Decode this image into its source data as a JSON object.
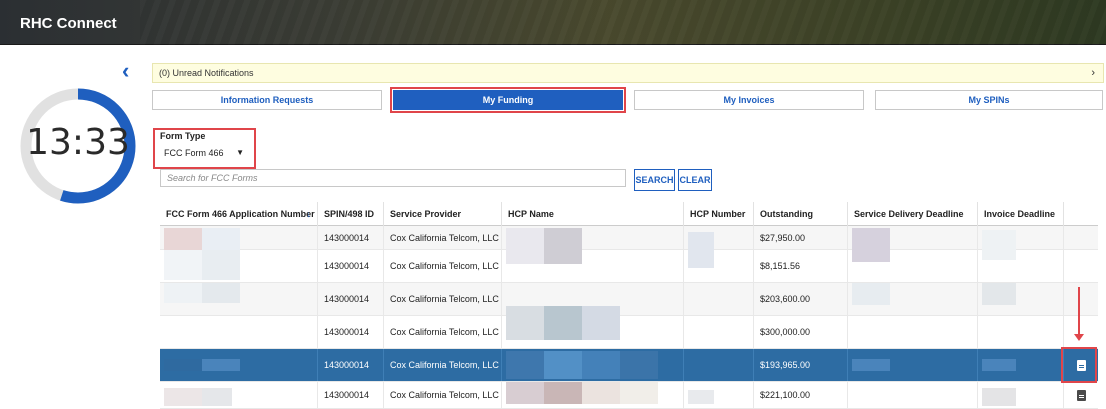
{
  "app": {
    "title": "RHC Connect"
  },
  "timer": {
    "time": "13:33",
    "remaining_fraction": 0.55
  },
  "notifications": {
    "label": "(0) Unread Notifications"
  },
  "tabs": [
    {
      "label": "Information Requests",
      "active": false
    },
    {
      "label": "My Funding",
      "active": true
    },
    {
      "label": "My Invoices",
      "active": false
    },
    {
      "label": "My SPINs",
      "active": false
    }
  ],
  "form_type": {
    "label": "Form Type",
    "value": "FCC Form 466"
  },
  "search": {
    "placeholder": "Search for FCC Forms",
    "search_label": "SEARCH",
    "clear_label": "CLEAR"
  },
  "table": {
    "columns": [
      "FCC Form 466 Application Number",
      "SPIN/498 ID",
      "Service Provider",
      "HCP Name",
      "HCP Number",
      "Outstanding Balance",
      "Service Delivery Deadline",
      "Invoice Deadline",
      ""
    ],
    "rows": [
      {
        "spin": "143000014",
        "provider": "Cox California Telcom, LLC",
        "balance": "$27,950.00"
      },
      {
        "spin": "143000014",
        "provider": "Cox California Telcom, LLC",
        "balance": "$8,151.56"
      },
      {
        "spin": "143000014",
        "provider": "Cox California Telcom, LLC",
        "balance": "$203,600.00"
      },
      {
        "spin": "143000014",
        "provider": "Cox California Telcom, LLC",
        "balance": "$300,000.00"
      },
      {
        "spin": "143000014",
        "provider": "Cox California Telcom, LLC",
        "balance": "$193,965.00",
        "selected": true
      },
      {
        "spin": "143000014",
        "provider": "Cox California Telcom, LLC",
        "balance": "$221,100.00"
      }
    ]
  },
  "colors": {
    "primary": "#1f5fbf",
    "selected_row": "#2d6ca3",
    "highlight": "#e0454a",
    "notification_bg": "#fefde0"
  }
}
